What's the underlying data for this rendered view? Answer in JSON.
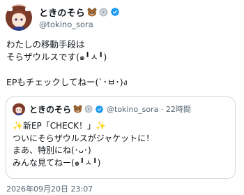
{
  "author": {
    "display_name": "ときのそら",
    "handle": "@tokino_sora",
    "name_emoji": [
      "bear-face-emoji",
      "silver-disc-emoji"
    ],
    "verified": true,
    "verified_color": "#1d9bf0"
  },
  "tweet": {
    "lines": [
      "わたしの移動手段は",
      "そらザウルスです(๑╹ㅅ╹)",
      "",
      "EPもチェックしてねー(`･ㅂ･)ง"
    ],
    "timestamp": "2026年09月20日 23:07"
  },
  "quoted_tweet": {
    "display_name": "ときのそら",
    "handle": "@tokino_sora",
    "separator": "·",
    "time_ago": "22時間",
    "lines": [
      "✨新EP「CHECK！」✨",
      "ついにそらザウルスがジャケットに！",
      "まあ、特別にね(･ᴗ･)",
      "みんな見てねー(๑╹ㅅ╹)"
    ]
  },
  "colors": {
    "text": "#0f1419",
    "secondary_text": "#536471",
    "border": "#cfd9de",
    "verified_badge": "#1d9bf0"
  }
}
